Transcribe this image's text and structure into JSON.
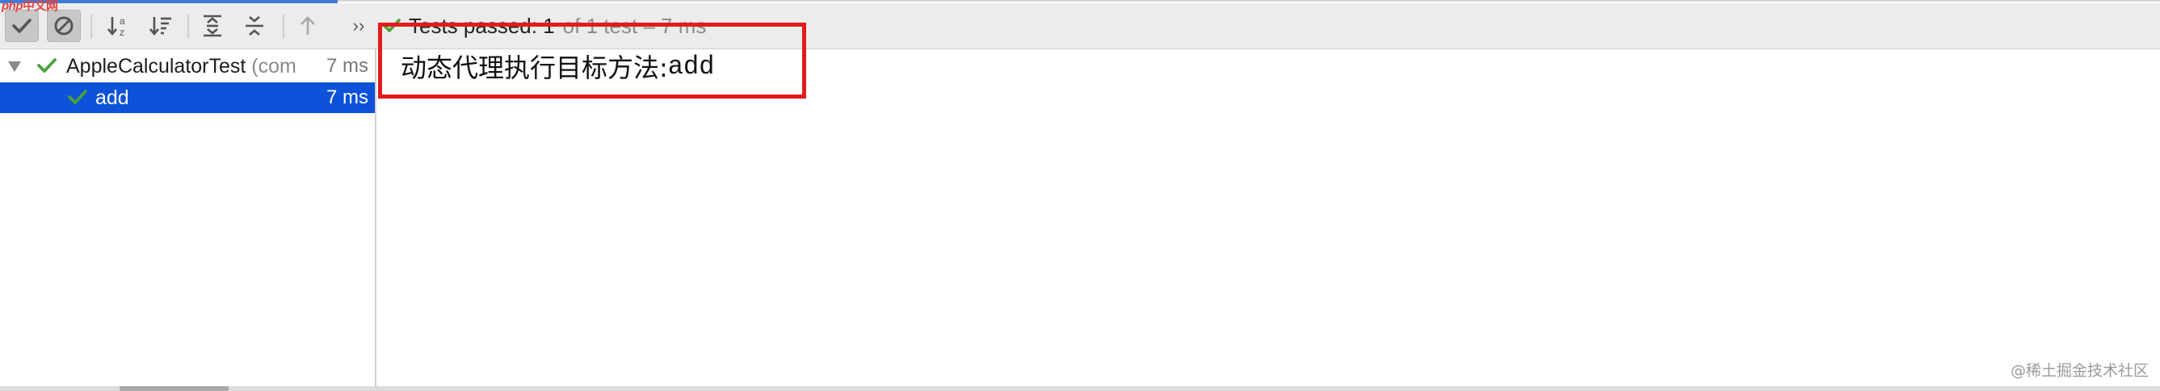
{
  "toolbar": {
    "buttons": [
      {
        "name": "show-passed",
        "icon": "check-icon",
        "toggled": true
      },
      {
        "name": "show-ignored",
        "icon": "cancel-icon",
        "toggled": true
      },
      {
        "name": "sort-alphabetically",
        "icon": "sort-alpha-icon",
        "toggled": false
      },
      {
        "name": "sort-by-duration",
        "icon": "sort-duration-icon",
        "toggled": false
      },
      {
        "name": "expand-all",
        "icon": "expand-all-icon",
        "toggled": false
      },
      {
        "name": "collapse-all",
        "icon": "collapse-all-icon",
        "toggled": false
      },
      {
        "name": "previous-failed",
        "icon": "arrow-up-icon",
        "toggled": false
      },
      {
        "name": "more",
        "icon": "chevrons-right-icon",
        "toggled": false
      }
    ],
    "more_label": "››",
    "status_main": "Tests passed: 1",
    "status_sub": "of 1 test – 7 ms"
  },
  "watermark": {
    "php": "php",
    "cn": "中文网",
    "site": "@稀土掘金技术社区"
  },
  "tree": {
    "root": {
      "name": "AppleCalculatorTest",
      "package": "(com",
      "time": "7 ms",
      "status": "passed"
    },
    "children": [
      {
        "name": "add",
        "time": "7 ms",
        "status": "passed",
        "selected": true
      }
    ]
  },
  "output": {
    "label": "动态代理执行目标方法:",
    "method": "add"
  },
  "colors": {
    "pass_green": "#4aa23a",
    "selection_blue": "#0d52d8",
    "highlight_red": "#e21b1b"
  }
}
